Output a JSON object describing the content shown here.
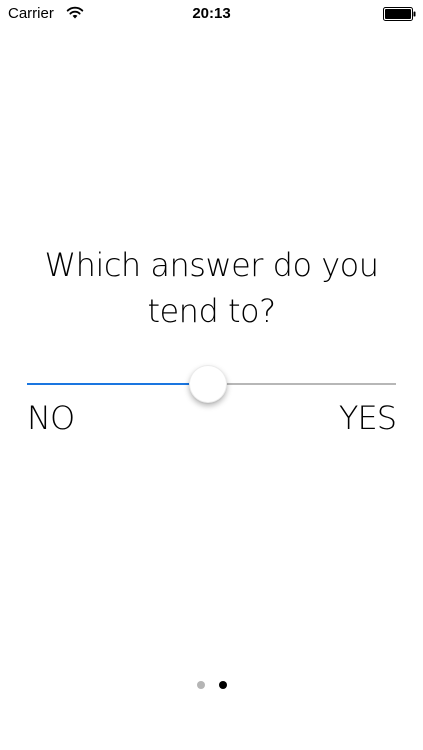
{
  "status_bar": {
    "carrier": "Carrier",
    "time": "20:13",
    "signal_icon": "wifi-icon",
    "battery_icon": "battery-icon"
  },
  "question": {
    "line1": "Which answer do you",
    "line2": "tend to?"
  },
  "slider": {
    "min_label": "NO",
    "max_label": "YES",
    "value": 0.49,
    "accent_color": "#1a76e0",
    "track_color": "#b7b7b7"
  },
  "page_control": {
    "page_count": 2,
    "current_page": 2
  }
}
